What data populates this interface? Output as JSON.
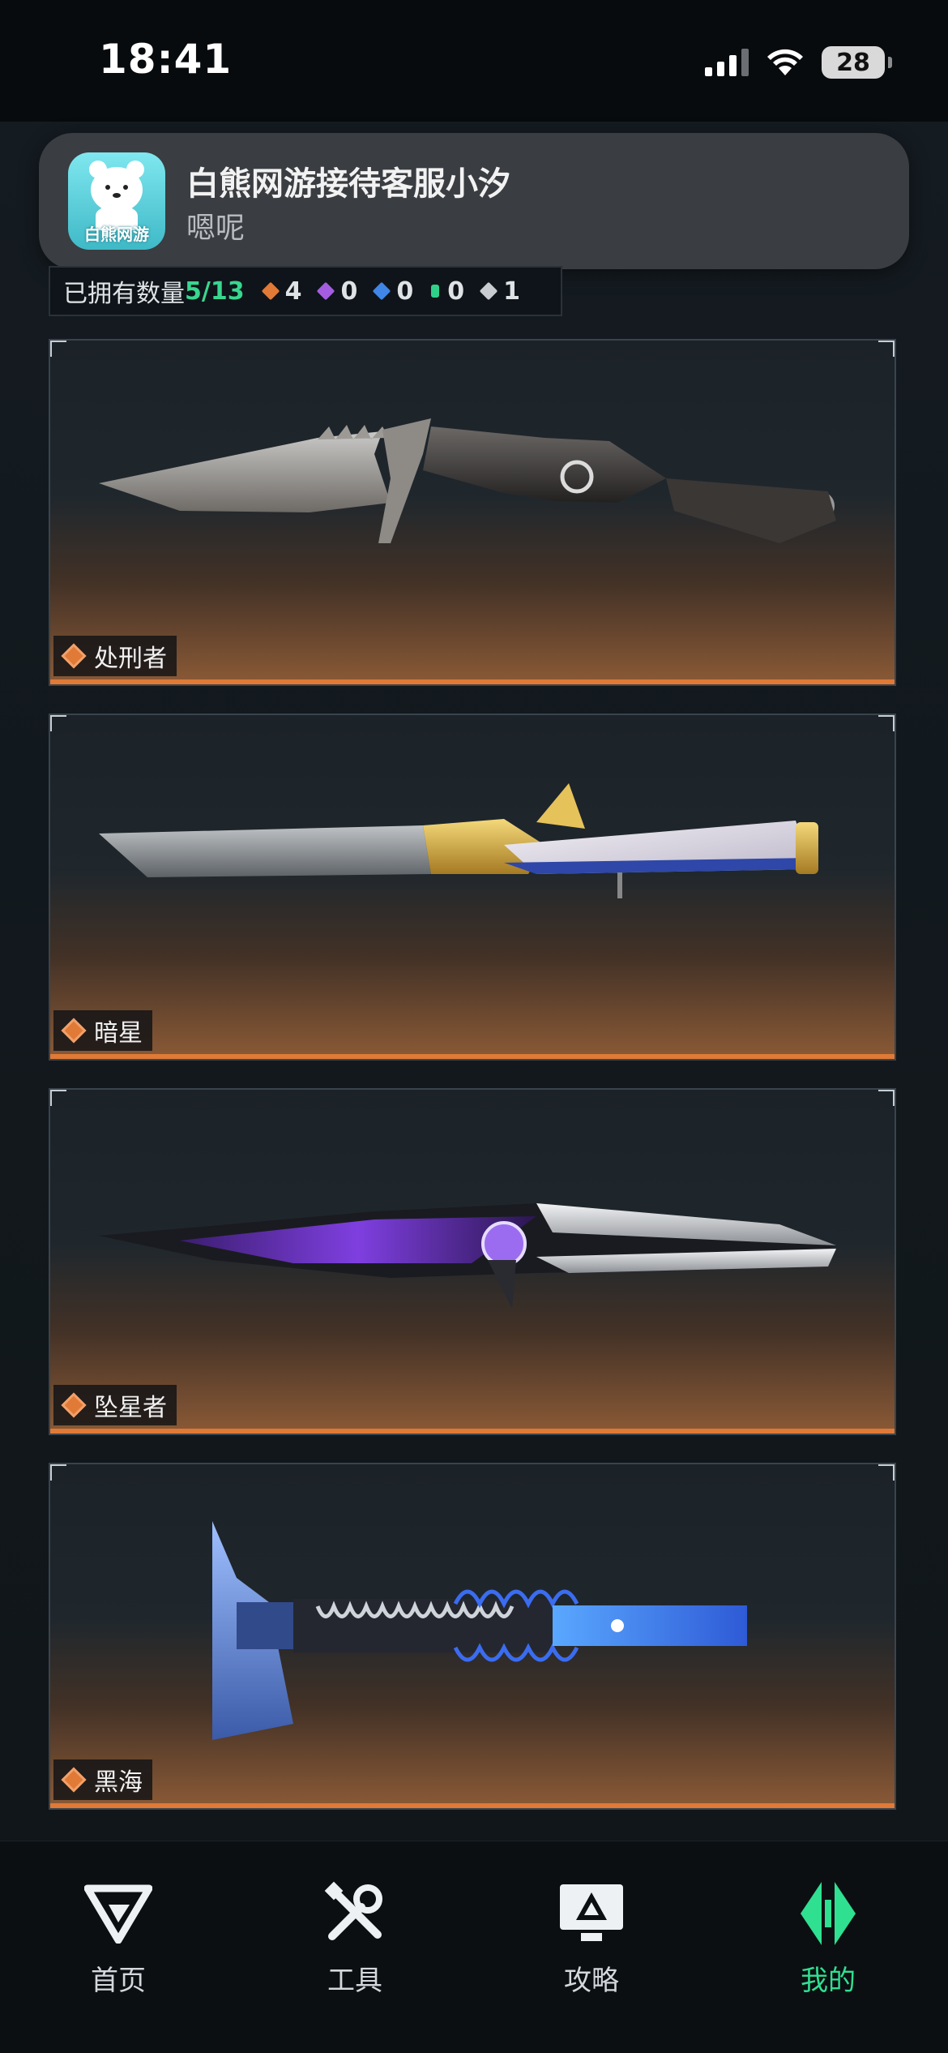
{
  "status_bar": {
    "time": "18:41",
    "battery": "28"
  },
  "notification": {
    "app_badge": "白熊网游",
    "title": "白熊网游接待客服小汐",
    "body": "嗯呢"
  },
  "owned_summary": {
    "label": "已拥有数量",
    "count": "5/13",
    "rarities": [
      {
        "color": "#e07a36",
        "value": "4"
      },
      {
        "color": "#a45de0",
        "value": "0"
      },
      {
        "color": "#3f86e6",
        "value": "0"
      },
      {
        "color": "#2fd189",
        "value": "0"
      },
      {
        "color": "#c9cdd1",
        "value": "1"
      }
    ]
  },
  "items": [
    {
      "name": "处刑者",
      "icon": "serrated-combat-knife"
    },
    {
      "name": "暗星",
      "icon": "gold-eagle-dagger"
    },
    {
      "name": "坠星者",
      "icon": "purple-blade-knife"
    },
    {
      "name": "黑海",
      "icon": "blue-tactical-axe"
    }
  ],
  "nav": [
    {
      "label": "首页",
      "icon": "home-logo-icon",
      "active": false
    },
    {
      "label": "工具",
      "icon": "tools-icon",
      "active": false
    },
    {
      "label": "攻略",
      "icon": "guide-monitor-icon",
      "active": false
    },
    {
      "label": "我的",
      "icon": "profile-logo-icon",
      "active": true
    }
  ],
  "colors": {
    "accent": "#2fe091",
    "rarity_orange": "#e07a36"
  }
}
